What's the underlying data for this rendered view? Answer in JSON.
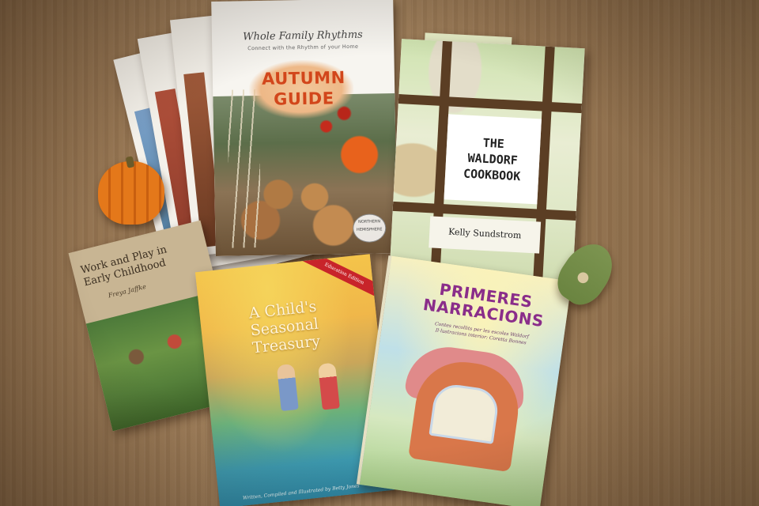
{
  "books": {
    "autumn": {
      "brand": "Whole Family Rhythms",
      "tagline": "Connect with the Rhythm of your Home",
      "title_line1": "AUTUMN",
      "title_line2": "GUIDE",
      "stamp": "NORTHERN HEMISPHERE"
    },
    "waldorf": {
      "title_line1": "THE",
      "title_line2": "WALDORF",
      "title_line3": "COOKBOOK",
      "author": "Kelly Sundstrom"
    },
    "work_play": {
      "title_line1": "Work and Play in",
      "title_line2": "Early Childhood",
      "author": "Freya Jaffke"
    },
    "treasury": {
      "ribbon": "Education Edition",
      "title_line1": "A Child's",
      "title_line2": "Seasonal",
      "title_line3": "Treasury",
      "credit": "Written, Compiled and Illustrated by Betty Jones"
    },
    "primeres": {
      "title_line1": "PRIMERES",
      "title_line2": "NARRACIONS",
      "subtitle_line1": "Contes recollits per les escoles Waldorf",
      "subtitle_line2": "Il·lustracions interior: Coretta Bonnes"
    }
  },
  "colors": {
    "wood": "#9b7a56",
    "pumpkin": "#e4781a",
    "autumn_title": "#d2461b",
    "primeres_title": "#8a2d8a",
    "ribbon": "#c8242a"
  }
}
